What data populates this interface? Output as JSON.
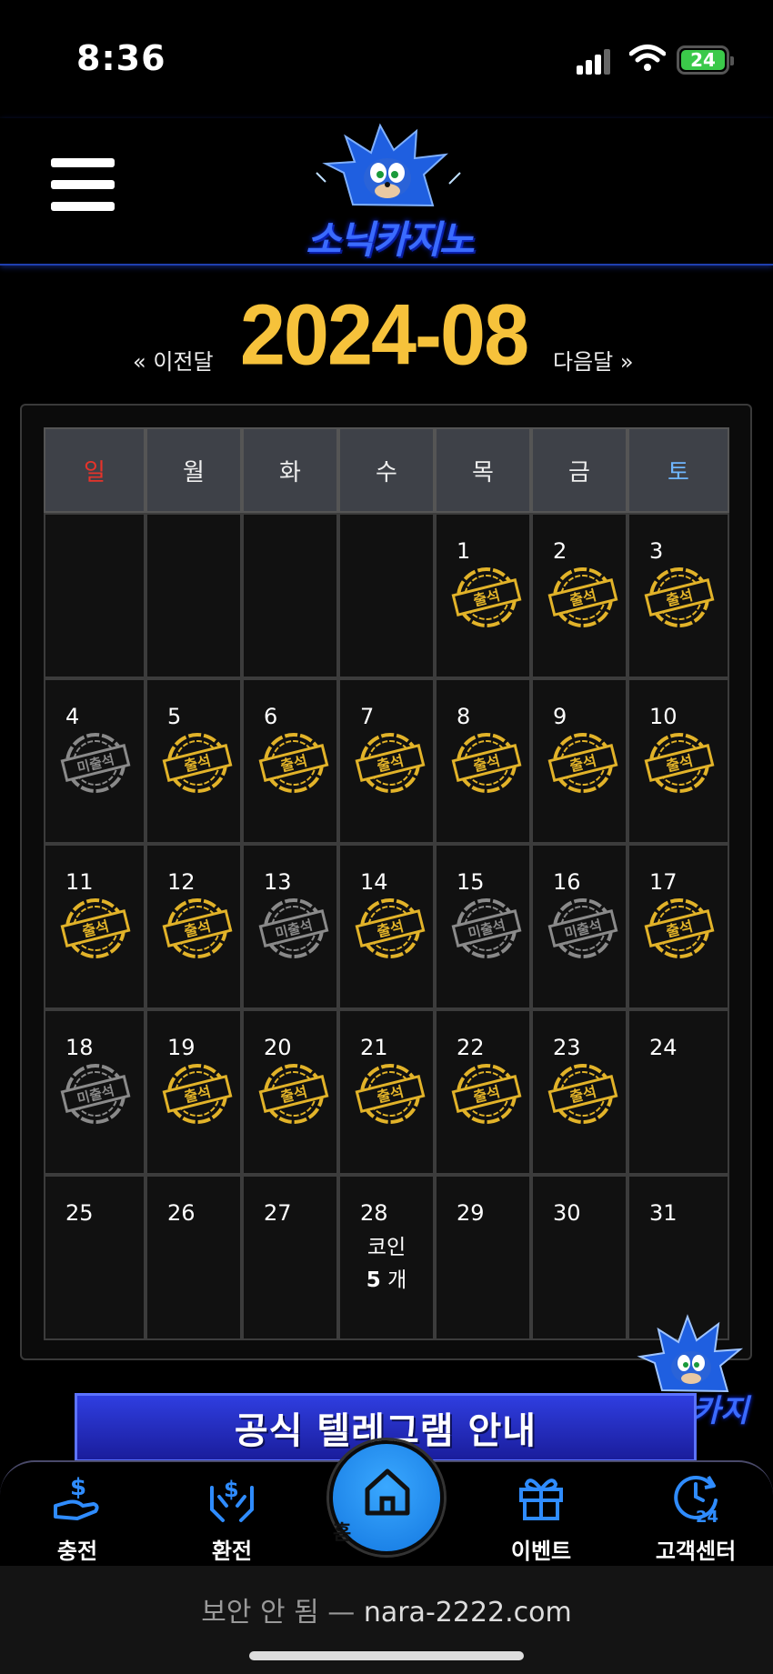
{
  "status": {
    "time": "8:36",
    "battery": "24"
  },
  "header": {
    "logo_text": "소닉카지노"
  },
  "month_nav": {
    "prev": "« 이전달",
    "title": "2024-08",
    "next": "다음달 »"
  },
  "calendar": {
    "weekdays": [
      "일",
      "월",
      "화",
      "수",
      "목",
      "금",
      "토"
    ],
    "weeks": [
      [
        {
          "day": "",
          "stamp": ""
        },
        {
          "day": "",
          "stamp": ""
        },
        {
          "day": "",
          "stamp": ""
        },
        {
          "day": "",
          "stamp": ""
        },
        {
          "day": "1",
          "stamp": "출석"
        },
        {
          "day": "2",
          "stamp": "출석"
        },
        {
          "day": "3",
          "stamp": "출석"
        }
      ],
      [
        {
          "day": "4",
          "stamp": "미출석"
        },
        {
          "day": "5",
          "stamp": "출석"
        },
        {
          "day": "6",
          "stamp": "출석"
        },
        {
          "day": "7",
          "stamp": "출석"
        },
        {
          "day": "8",
          "stamp": "출석"
        },
        {
          "day": "9",
          "stamp": "출석"
        },
        {
          "day": "10",
          "stamp": "출석"
        }
      ],
      [
        {
          "day": "11",
          "stamp": "출석"
        },
        {
          "day": "12",
          "stamp": "출석"
        },
        {
          "day": "13",
          "stamp": "미출석"
        },
        {
          "day": "14",
          "stamp": "출석"
        },
        {
          "day": "15",
          "stamp": "미출석"
        },
        {
          "day": "16",
          "stamp": "미출석"
        },
        {
          "day": "17",
          "stamp": "출석"
        }
      ],
      [
        {
          "day": "18",
          "stamp": "미출석"
        },
        {
          "day": "19",
          "stamp": "출석"
        },
        {
          "day": "20",
          "stamp": "출석"
        },
        {
          "day": "21",
          "stamp": "출석"
        },
        {
          "day": "22",
          "stamp": "출석"
        },
        {
          "day": "23",
          "stamp": "출석"
        },
        {
          "day": "24",
          "stamp": ""
        }
      ],
      [
        {
          "day": "25",
          "stamp": ""
        },
        {
          "day": "26",
          "stamp": ""
        },
        {
          "day": "27",
          "stamp": ""
        },
        {
          "day": "28",
          "stamp": "",
          "coin_label": "코인",
          "coin_count": "5",
          "coin_unit": " 개"
        },
        {
          "day": "29",
          "stamp": ""
        },
        {
          "day": "30",
          "stamp": ""
        },
        {
          "day": "31",
          "stamp": ""
        }
      ]
    ]
  },
  "floating_badge": {
    "text": "소닉카지"
  },
  "telegram_banner": {
    "text": "공식 텔레그램 안내"
  },
  "bottom_nav": {
    "items": [
      {
        "label": "충전",
        "icon": "charge-icon"
      },
      {
        "label": "환전",
        "icon": "exchange-icon"
      },
      {
        "label": "홈",
        "icon": "home-icon"
      },
      {
        "label": "이벤트",
        "icon": "gift-icon"
      },
      {
        "label": "고객센터",
        "icon": "support-24-icon"
      }
    ]
  },
  "url_bar": {
    "security": "보안 안 됨 —",
    "domain": "nara-2222.com"
  },
  "colors": {
    "gold": "#f6c23b",
    "accent_blue": "#1f6fff",
    "sunday": "#e6332a",
    "saturday": "#6fb6ff",
    "stamp_gold": "#e2b329",
    "stamp_gray": "#8a8a8a"
  }
}
